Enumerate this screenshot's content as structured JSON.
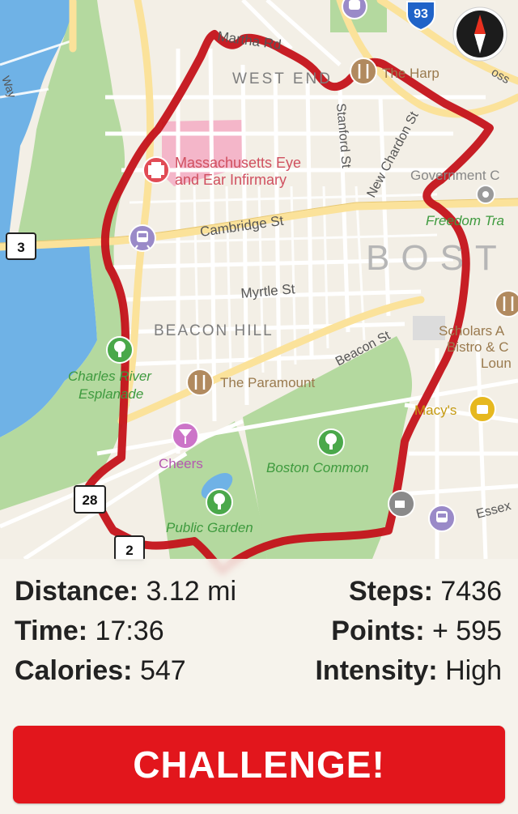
{
  "map": {
    "labels": {
      "martha_rd": "Martha Rd",
      "west_end": "WEST END",
      "the_harp": "The Harp",
      "stanford_st": "Stanford St",
      "new_chardon_st": "New Chardon St",
      "government_center": "Government C",
      "mass_eye_ear_1": "Massachusetts Eye",
      "mass_eye_ear_2": "and Ear Infirmary",
      "cambridge_st": "Cambridge St",
      "freedom_trail": "Freedom Tra",
      "boston": "BOST",
      "myrtle_st": "Myrtle St",
      "beacon_hill": "BEACON HILL",
      "beacon_st": "Beacon St",
      "scholars_1": "Scholars A",
      "scholars_2": "Bistro & C",
      "scholars_3": "Loun",
      "charles_river_1": "Charles River",
      "charles_river_2": "Esplanade",
      "the_paramount": "The Paramount",
      "macys": "Macy's",
      "cheers": "Cheers",
      "boston_common": "Boston Common",
      "public_garden": "Public Garden",
      "essex": "Essex",
      "route_3": "3",
      "route_28": "28",
      "route_2": "2",
      "interstate_93": "93",
      "moss": "oss",
      "way": "Way"
    },
    "colors": {
      "water": "#6fb2e6",
      "park": "#b4d99f",
      "land": "#f3efe6",
      "street": "#ffffff",
      "highway": "#fbe29a",
      "hospital": "#f4b6c9",
      "route": "#c4121a"
    }
  },
  "stats": {
    "distance": {
      "label": "Distance:",
      "value": "3.12 mi"
    },
    "time": {
      "label": "Time:",
      "value": "17:36"
    },
    "calories": {
      "label": "Calories:",
      "value": "547"
    },
    "steps": {
      "label": "Steps:",
      "value": "7436"
    },
    "points": {
      "label": "Points:",
      "value": "+ 595"
    },
    "intensity": {
      "label": "Intensity:",
      "value": "High"
    }
  },
  "challenge_button": {
    "label": "CHALLENGE!"
  },
  "compass": {
    "letter": "N"
  }
}
